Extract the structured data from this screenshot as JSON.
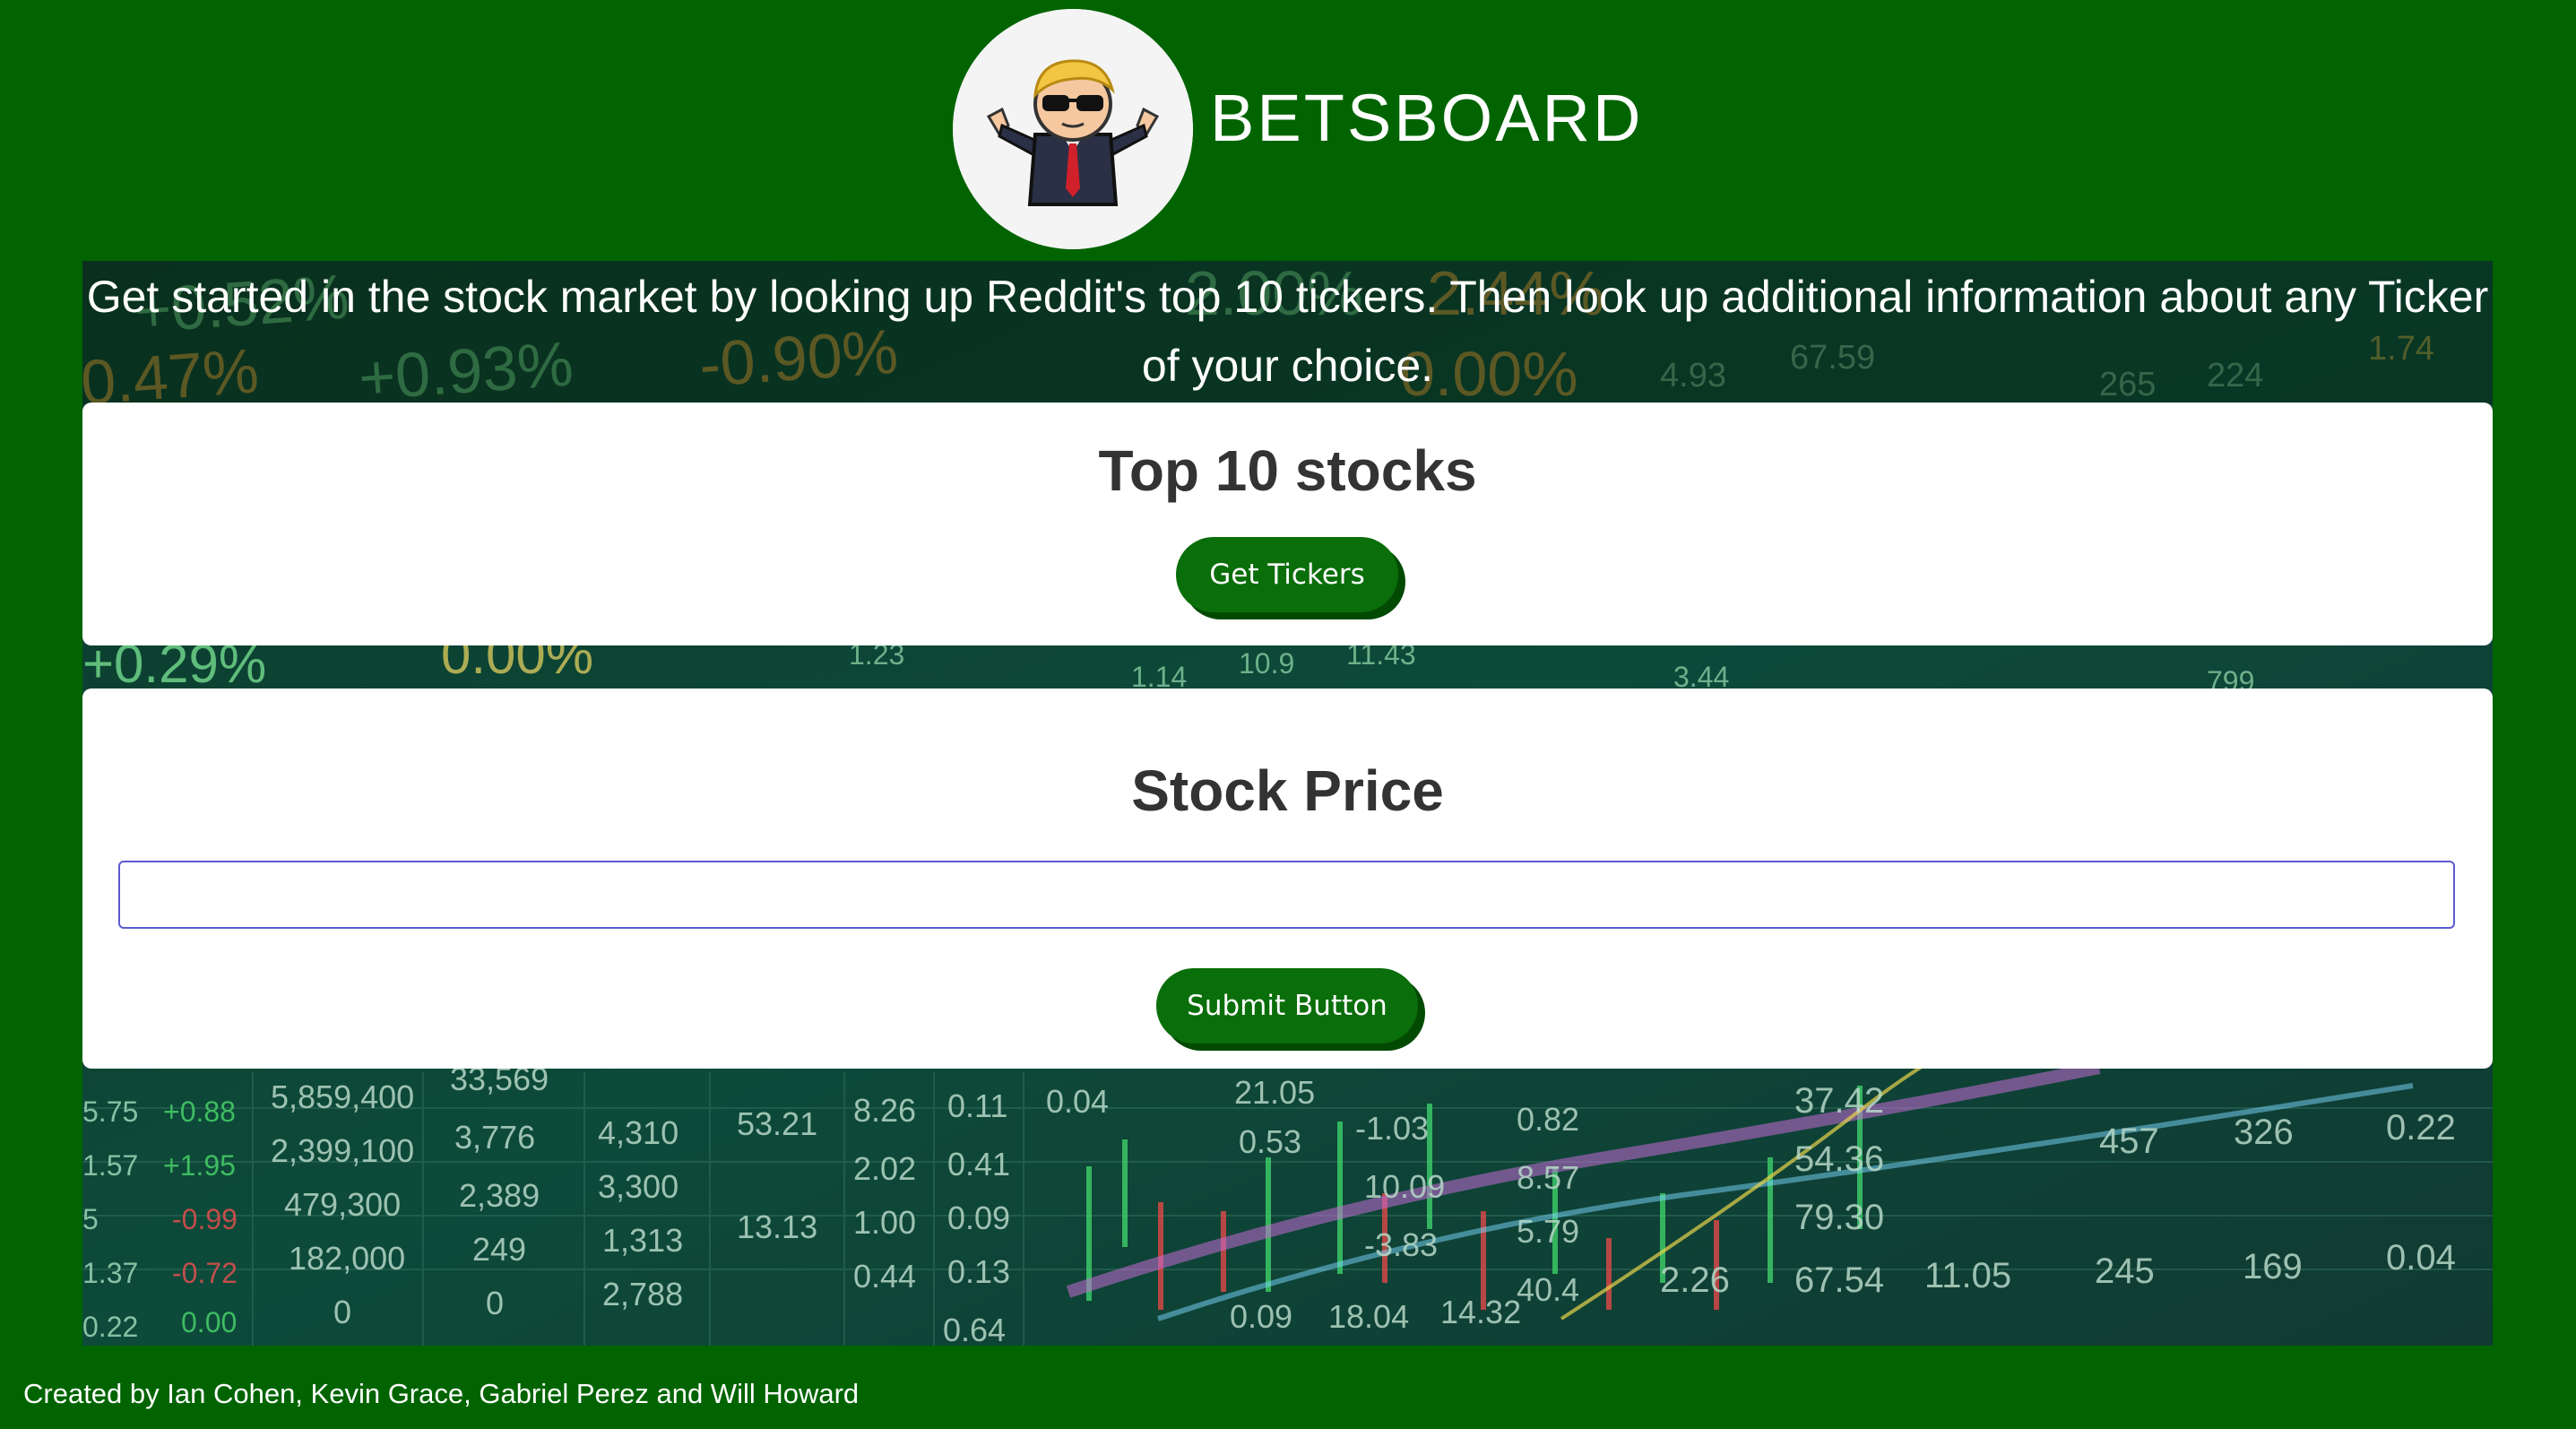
{
  "header": {
    "brand": "BETSBOARD"
  },
  "hero": {
    "intro": "Get started in the stock market by looking up Reddit's top 10 tickers. Then look up additional information about any Ticker of your choice."
  },
  "top_stocks": {
    "title": "Top 10 stocks",
    "button_label": "Get Tickers"
  },
  "stock_price": {
    "title": "Stock Price",
    "input_value": "",
    "input_placeholder": "",
    "button_label": "Submit Button"
  },
  "background_ticker_numbers": [
    "+0.52%",
    "0.47%",
    "+0.93%",
    "-0.90%",
    "2.00%",
    "2.44%",
    "4.93",
    "67.59",
    "224",
    "1.74",
    "265",
    "+0.29%",
    "0.00%",
    "1.23",
    "1.14",
    "10.9",
    "11.43",
    "3.44",
    "799",
    "5.75",
    "+0.88",
    "5,859,400",
    "33,569",
    "1.57",
    "+1.95",
    "2,399,100",
    "3,776",
    "4,310",
    "53.21",
    "8.26",
    "0.11",
    "0.04",
    "21.05",
    "5",
    "-0.99",
    "479,300",
    "2,389",
    "3,300",
    "2.02",
    "0.41",
    "0.53",
    "-1.03",
    "0.82",
    "37.42",
    "457",
    "326",
    "0.22",
    "1.37",
    "-0.72",
    "182,000",
    "249",
    "1,313",
    "13.13",
    "1.00",
    "0.09",
    "10.09",
    "8.57",
    "54.36",
    "0.22",
    "0.00",
    "0",
    "0",
    "2,788",
    "0.44",
    "0.13",
    "-3.83",
    "5.79",
    "79.30",
    "245",
    "169",
    "0.04",
    "0.64",
    "0.09",
    "18.04",
    "14.32",
    "40.4",
    "2.26",
    "67.54",
    "11.05"
  ],
  "footer": {
    "credits": "Created by Ian Cohen, Kevin Grace, Gabriel Perez and Will Howard"
  },
  "colors": {
    "page_background": "#016400",
    "button": "#0a6e0a",
    "button_shadow": "#024a02",
    "card": "#ffffff",
    "heading": "#333333",
    "input_border": "#5a5ad1"
  },
  "icons": {
    "logo": "wallstreetbets-mascot-icon"
  }
}
